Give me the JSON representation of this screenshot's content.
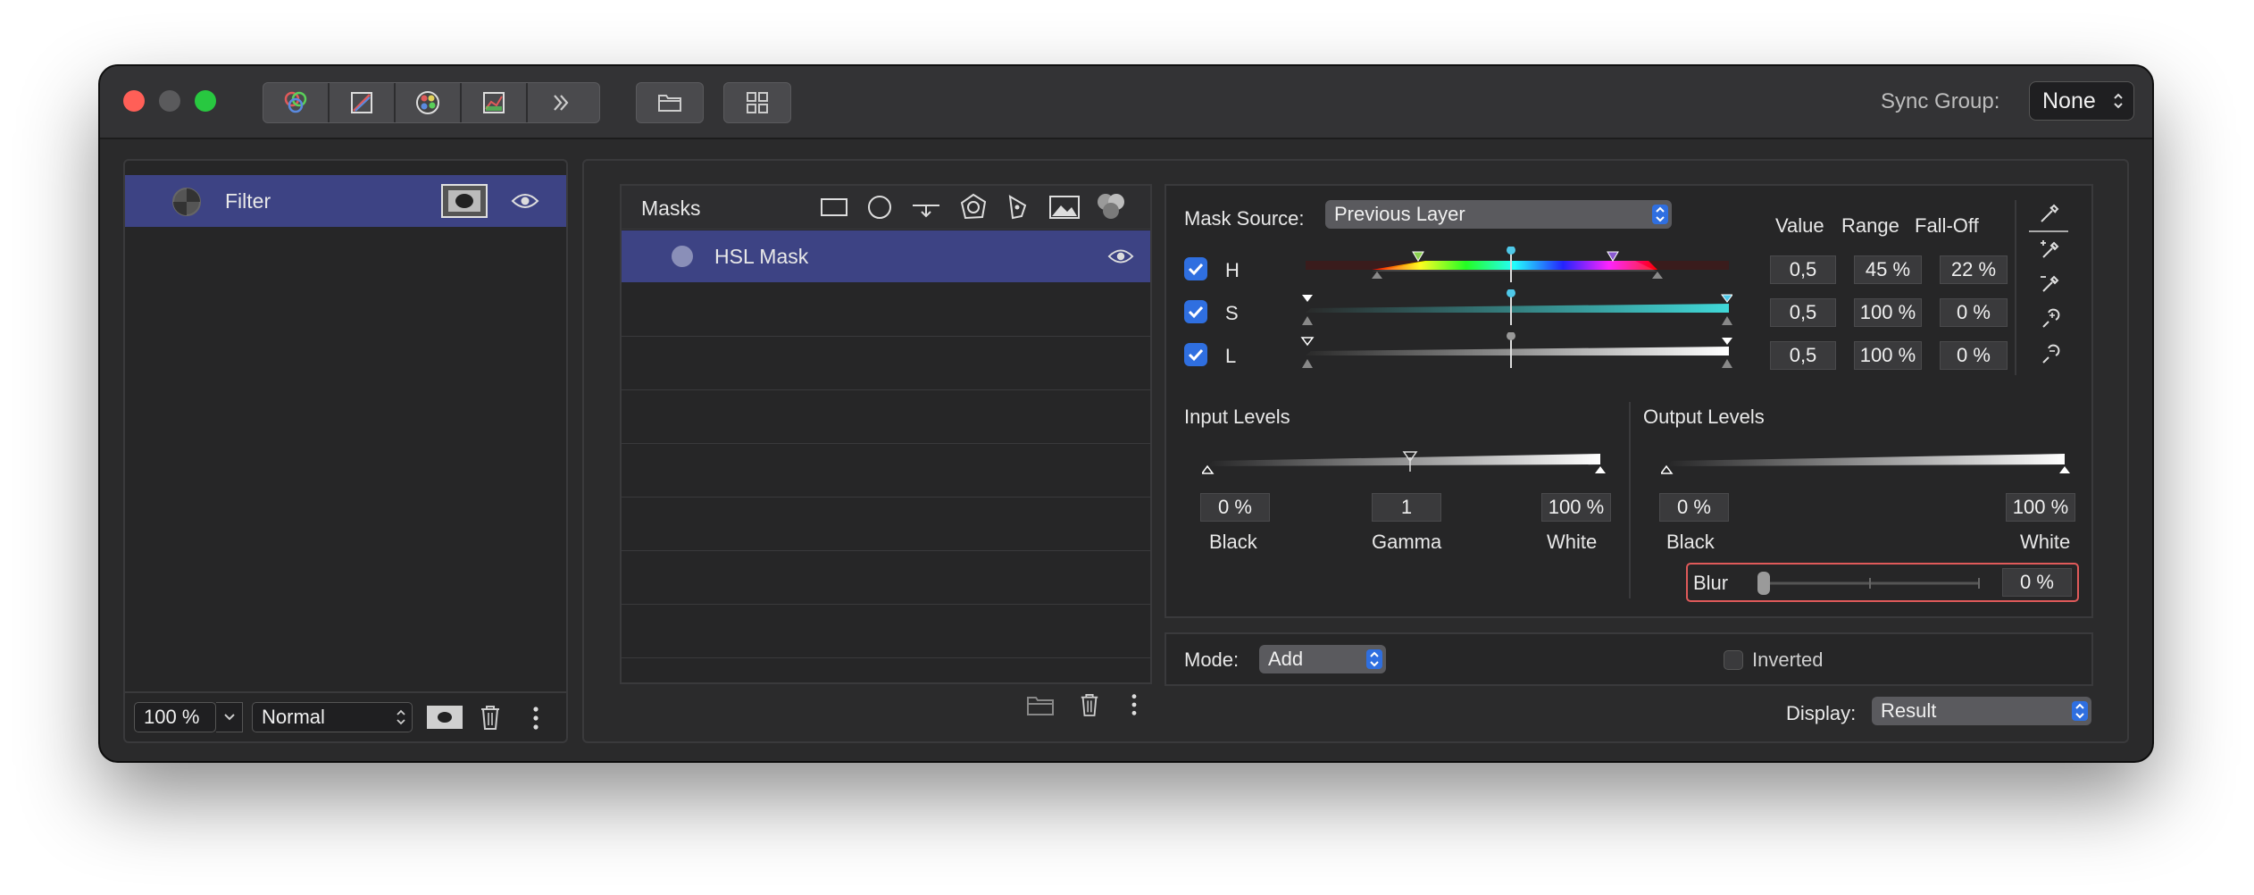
{
  "toolbar": {
    "buttons": [
      "layers-icon",
      "curves-icon",
      "color-wheel-icon",
      "levels-icon",
      "chevrons-right-icon"
    ],
    "folder_icon": "folder-icon",
    "grid_icon": "grid-icon",
    "sync_group_label": "Sync Group:",
    "sync_group_value": "None"
  },
  "layers": {
    "items": [
      {
        "label": "Filter",
        "selected": true
      }
    ],
    "opacity": "100 %",
    "blend_mode": "Normal"
  },
  "masks": {
    "header": "Masks",
    "tools": [
      "rectangle-icon",
      "ellipse-icon",
      "gradient-icon",
      "polygon-icon",
      "pen-icon",
      "image-icon",
      "color-mask-icon"
    ],
    "items": [
      {
        "label": "HSL Mask",
        "selected": true
      }
    ]
  },
  "hsl": {
    "mask_source_label": "Mask Source:",
    "mask_source_value": "Previous Layer",
    "col_value": "Value",
    "col_range": "Range",
    "col_falloff": "Fall-Off",
    "rows": [
      {
        "label": "H",
        "checked": true,
        "value": "0,5",
        "range": "45 %",
        "falloff": "22 %"
      },
      {
        "label": "S",
        "checked": true,
        "value": "0,5",
        "range": "100 %",
        "falloff": "0 %"
      },
      {
        "label": "L",
        "checked": true,
        "value": "0,5",
        "range": "100 %",
        "falloff": "0 %"
      }
    ]
  },
  "input_levels": {
    "title": "Input Levels",
    "black": "0 %",
    "gamma": "1",
    "white": "100 %",
    "black_label": "Black",
    "gamma_label": "Gamma",
    "white_label": "White"
  },
  "output_levels": {
    "title": "Output Levels",
    "black": "0 %",
    "white": "100 %",
    "black_label": "Black",
    "white_label": "White"
  },
  "blur": {
    "label": "Blur",
    "value": "0 %",
    "level": 0
  },
  "mode": {
    "label": "Mode:",
    "value": "Add",
    "inverted_label": "Inverted",
    "inverted": false
  },
  "display": {
    "label": "Display:",
    "value": "Result"
  },
  "colors": {
    "selection": "#3d4384",
    "accent": "#2f6fe0",
    "highlight_border": "#e05a5a"
  }
}
